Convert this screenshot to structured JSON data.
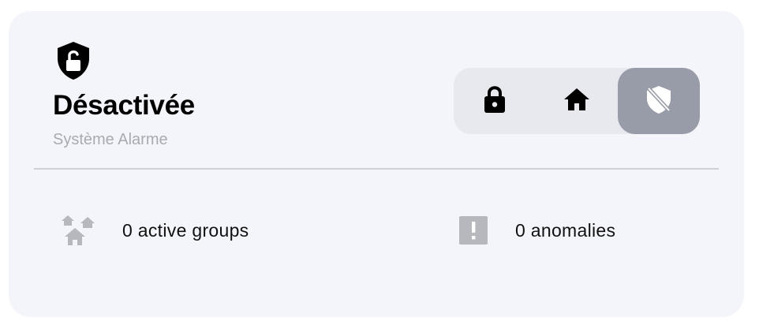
{
  "panel": {
    "status_title": "Désactivée",
    "status_subtitle": "Système Alarme",
    "status_icon": "shield-unlocked-icon"
  },
  "mode_switch": {
    "options": [
      {
        "icon": "lock-icon",
        "mode": "armed-away",
        "active": false
      },
      {
        "icon": "home-icon",
        "mode": "armed-home",
        "active": false
      },
      {
        "icon": "shield-off-icon",
        "mode": "disarmed",
        "active": true
      }
    ]
  },
  "stats": {
    "groups": {
      "icon": "houses-icon",
      "label": "0 active groups"
    },
    "anomalies": {
      "icon": "alert-square-icon",
      "label": "0 anomalies"
    }
  },
  "colors": {
    "card_background": "#f4f5fa",
    "switch_background": "#e8e9ee",
    "active_option": "#989ca9",
    "subtitle": "#a9aab2",
    "stat_icon": "#b7b8bd"
  }
}
